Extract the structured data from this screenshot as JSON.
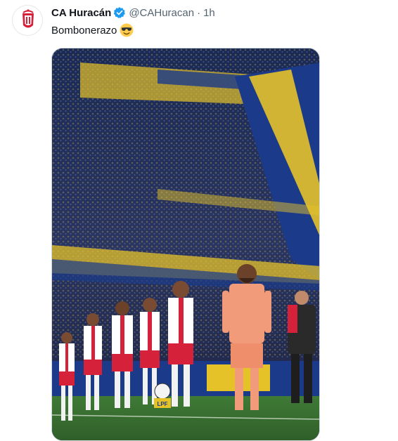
{
  "tweet": {
    "display_name": "CA Huracán",
    "handle": "@CAHuracan",
    "separator": "·",
    "time": "1h",
    "text": "Bombonerazo",
    "emoji": "smiling-face-with-sunglasses-icon",
    "verified_badge": "verified-badge-icon",
    "avatar": "ca-huracan-crest-icon"
  },
  "media": {
    "description_icon": "stadium-photo",
    "ball_sign": "LPF"
  },
  "colors": {
    "verified_blue": "#1d9bf0",
    "handle_gray": "#536471",
    "boca_blue": "#1b3a8a",
    "boca_yellow": "#e6c229",
    "huracan_red": "#d6213a",
    "keeper_orange": "#f29b7a"
  }
}
